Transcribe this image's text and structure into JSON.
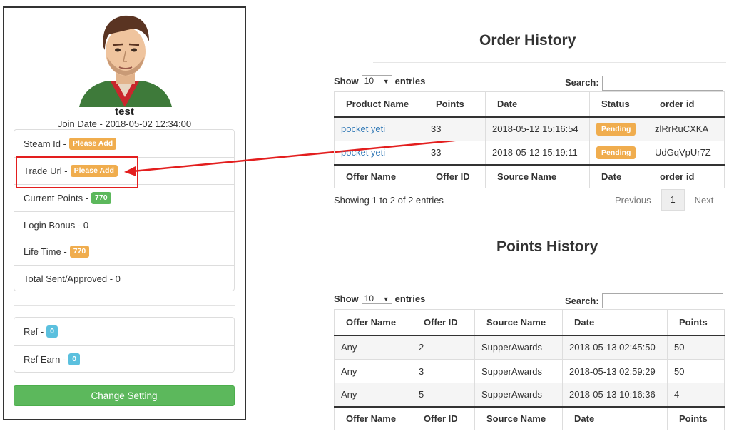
{
  "profile": {
    "username": "test",
    "join_date": "Join Date - 2018-05-02 12:34:00",
    "items": [
      {
        "label": "Steam Id - ",
        "badge": "Please Add"
      },
      {
        "label": "Trade Url - ",
        "badge": "Please Add"
      },
      {
        "label": "Current Points - ",
        "badge": "770"
      },
      {
        "label": "Login Bonus - 0"
      },
      {
        "label": "Life Time - ",
        "badge": "770"
      },
      {
        "label": "Total Sent/Approved - 0"
      }
    ],
    "ref_items": [
      {
        "label": "Ref - ",
        "badge": "0"
      },
      {
        "label": "Ref Earn - ",
        "badge": "0"
      }
    ],
    "change_button": "Change Setting"
  },
  "order_history": {
    "title": "Order History",
    "show_label": "Show",
    "page_size": "10",
    "entries_label": "entries",
    "search_label": "Search:",
    "headers": [
      "Product Name",
      "Points",
      "Date",
      "Status",
      "order id"
    ],
    "rows": [
      [
        "pocket yeti",
        "33",
        "2018-05-12 15:16:54",
        "Pending",
        "zlRrRuCXKA"
      ],
      [
        "pocket yeti",
        "33",
        "2018-05-12 15:19:11",
        "Pending",
        "UdGqVpUr7Z"
      ]
    ],
    "footer": [
      "Offer Name",
      "Offer ID",
      "Source Name",
      "Date",
      "order id"
    ],
    "info": "Showing 1 to 2 of 2 entries",
    "pagination": {
      "previous": "Previous",
      "page": "1",
      "next": "Next"
    }
  },
  "points_history": {
    "title": "Points History",
    "show_label": "Show",
    "page_size": "10",
    "entries_label": "entries",
    "search_label": "Search:",
    "headers": [
      "Offer Name",
      "Offer ID",
      "Source Name",
      "Date",
      "Points"
    ],
    "rows": [
      [
        "Any",
        "2",
        "SupperAwards",
        "2018-05-13 02:45:50",
        "50"
      ],
      [
        "Any",
        "3",
        "SupperAwards",
        "2018-05-13 02:59:29",
        "50"
      ],
      [
        "Any",
        "5",
        "SupperAwards",
        "2018-05-13 10:16:36",
        "4"
      ]
    ],
    "footer": [
      "Offer Name",
      "Offer ID",
      "Source Name",
      "Date",
      "Points"
    ]
  },
  "colors": {
    "warning": "#f0ad4e",
    "success": "#5cb85c",
    "info": "#5bc0de",
    "link": "#337ab7",
    "annotation": "#e31e1e"
  }
}
